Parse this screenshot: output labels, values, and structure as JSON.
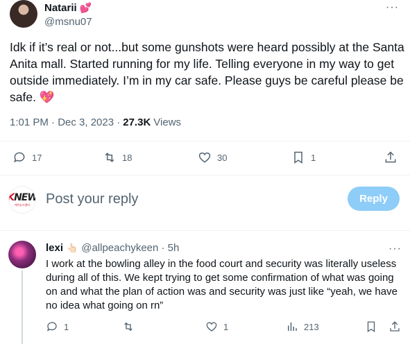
{
  "tweet": {
    "display_name": "Natarii",
    "name_emoji": "💕",
    "handle": "@msnu07",
    "more_label": "···",
    "text": "Idk if it’s real or not...but some gunshots were heard possibly at the Santa Anita mall. Started running for my life. Telling everyone in my way to get outside immediately. I’m in my car safe. Please guys be careful please be safe. 💖",
    "time": "1:01 PM · Dec 3, 2023 ·",
    "views_count": "27.3K",
    "views_label": "Views"
  },
  "actions": {
    "replies": "17",
    "reposts": "18",
    "likes": "30",
    "bookmarks": "1"
  },
  "compose": {
    "avatar_text_1": "K",
    "avatar_text_2": "NEW",
    "avatar_sub": "케이뉴스엔터",
    "placeholder": "Post your reply",
    "reply_button": "Reply"
  },
  "reply": {
    "name": "lexi",
    "name_emoji": "👆🏻",
    "handle": "@allpeachykeen · 5h",
    "more_label": "···",
    "text": "I work at the bowling alley in the food court and security was literally useless during all of this. We kept trying to get some confirmation of what was going on and what the plan of action was and security was just like “yeah, we have no idea what going on rn”",
    "actions": {
      "replies": "1",
      "reposts": "",
      "likes": "1",
      "views": "213"
    }
  },
  "colors": {
    "text": "#0f1419",
    "muted": "#536471",
    "reply_button": "#8ecdf8",
    "divider": "#eff3f4"
  }
}
